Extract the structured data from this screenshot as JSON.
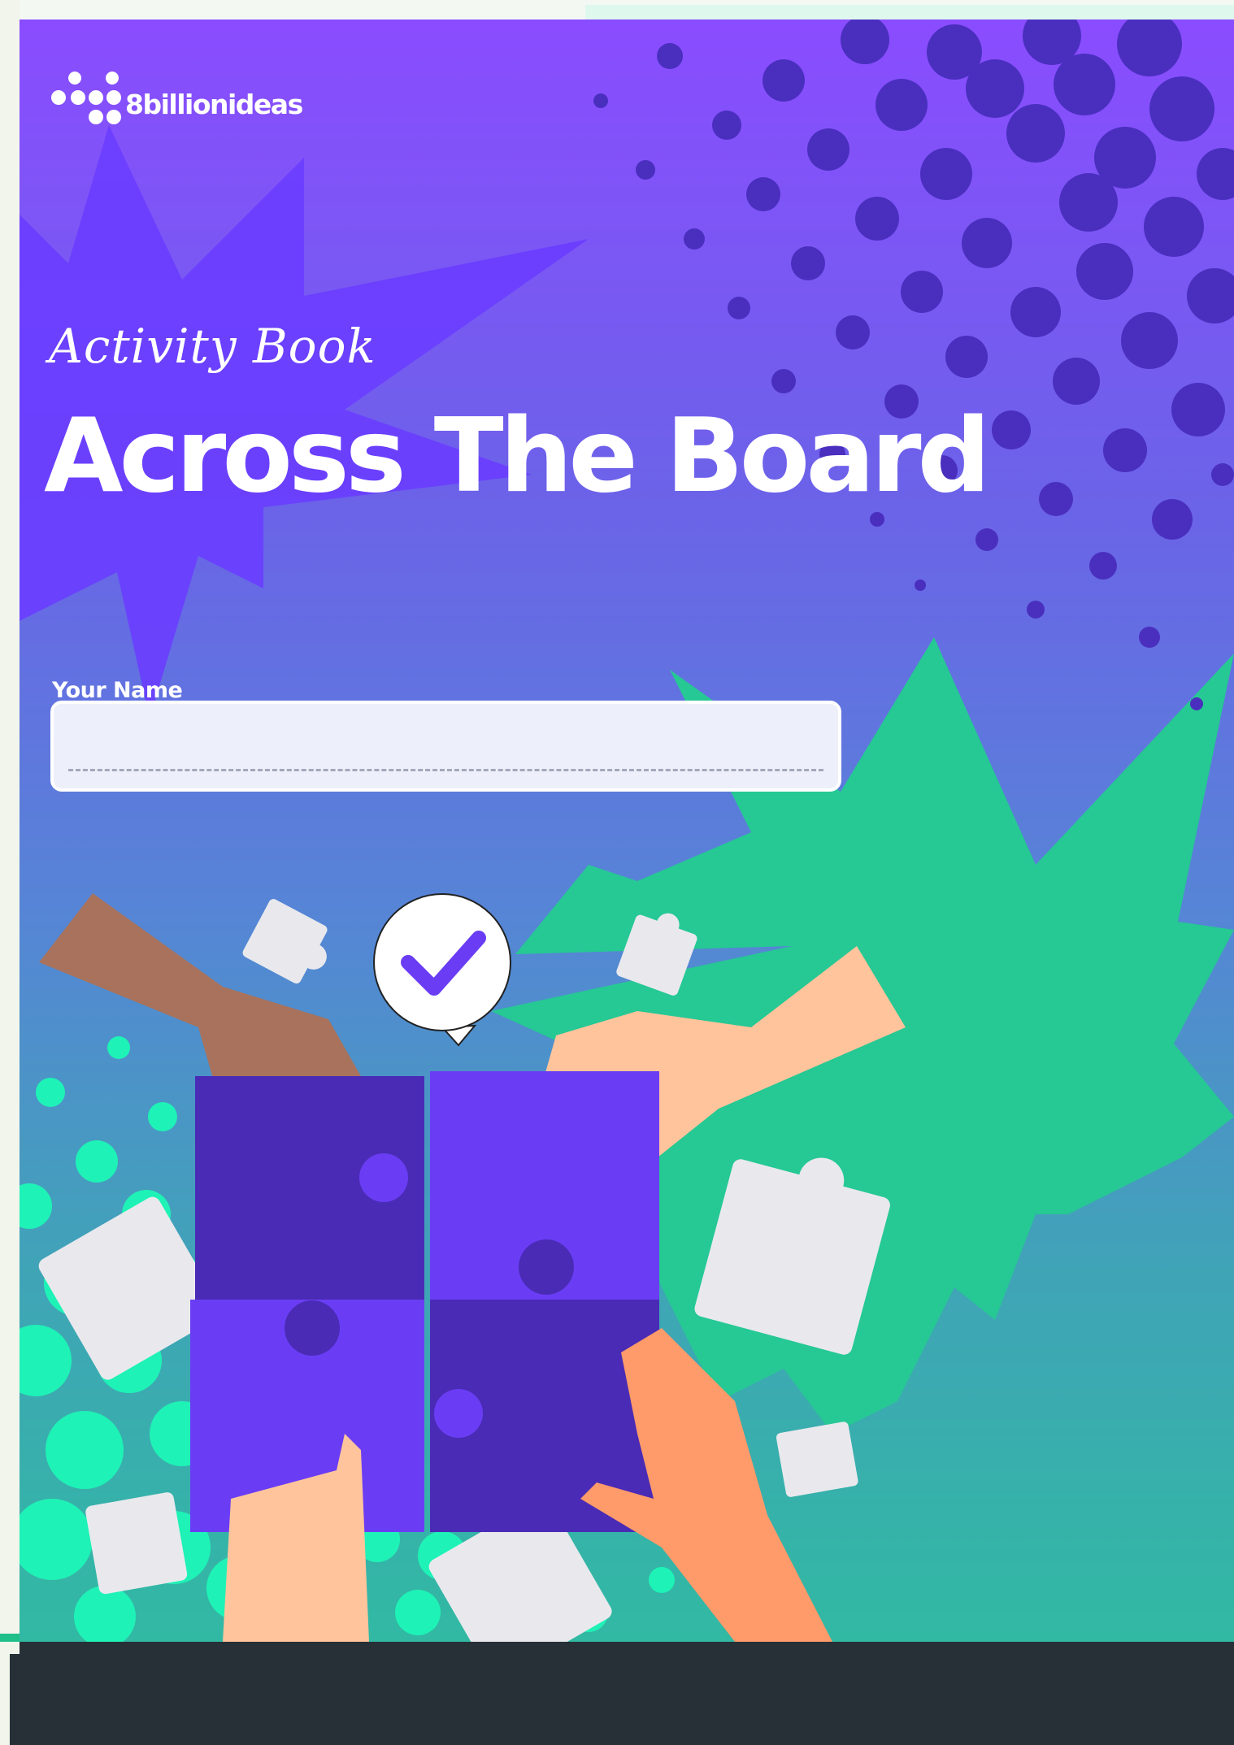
{
  "brand": {
    "logo_text": "8billionideas"
  },
  "cover": {
    "kicker": "Activity Book",
    "title": "Across The Board",
    "name_label": "Your Name",
    "name_value": ""
  },
  "artwork": {
    "icons": [
      "puzzle-piece-icon",
      "check-icon",
      "hand-icon",
      "starburst-shape"
    ],
    "colors": {
      "bg_top": "#8a4cff",
      "bg_bottom": "#31b9a3",
      "burst_green": "#26c894",
      "burst_purple": "#6a3dff",
      "halftone_dots": "#4a2fbf",
      "puzzle_dark": "#4a2bb5",
      "puzzle_light": "#6a3df5",
      "puzzle_grey": "#e9e9ed",
      "footer": "#263036"
    }
  }
}
